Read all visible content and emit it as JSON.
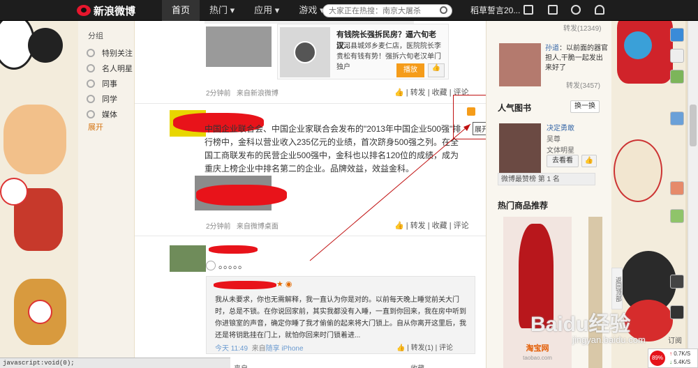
{
  "topbar": {
    "brand": "新浪微博",
    "nav": [
      "首页",
      "热门",
      "应用",
      "游戏"
    ],
    "search_placeholder": "大家正在热搜：南京大屠杀",
    "user": "稻草誓言20..."
  },
  "left": {
    "title": "分组",
    "groups": [
      "特别关注",
      "名人明星",
      "同事",
      "同学",
      "媒体"
    ],
    "expand": "展开"
  },
  "post1": {
    "card_title": "有钱院长强拆民房？逼六旬老汉...",
    "card_text": "唐河县城郊乡麦仁店，医院院长李贵松有钱有势！强拆六旬老汉单门独户",
    "card_btn": "播放",
    "time": "2分钟前",
    "source_pre": "来自",
    "source": "新浪微博",
    "acts": [
      "转发",
      "收藏",
      "评论"
    ]
  },
  "post2": {
    "text": "中国企业联合会、中国企业家联合会发布的\"2013年中国企业500强\"排行榜中，金科以营业收入235亿元的业绩，首次跻身500强之列。在全国工商联发布的民营企业500强中，金科也以排名120位的成绩，成为重庆上榜企业中排名第二的企业。品牌效益，效益金科。",
    "time": "2分钟前",
    "source_pre": "来自",
    "source": "微博桌面",
    "acts": [
      "转发",
      "收藏",
      "评论"
    ],
    "tooltip": "展开屏蔽选项"
  },
  "post3": {
    "dots": "。。。。。",
    "quote": "我从未要求，你也无需解释，我一直认为你是对的。以前每天晚上睡觉前关大门时，总是不锁。在你说回家前，其实我都没有入睡，一直到你回来，我在房中听到你进锒室的声音，确定你睡了我才偷偷的起来将大门锁上。自从你离开这里后，我还是将钥匙挂在门上，就怕你回来时门锁着进...",
    "time": "今天 11:49",
    "source_pre": "来自",
    "source": "随享 iPhone",
    "acts": [
      "转发(1)",
      "收藏",
      "评论"
    ]
  },
  "right": {
    "repost1": "转发(12349)",
    "user": "孙道",
    "text": "：以前面的器官担人,干脆一起发出来好了",
    "repost2": "转发(3457)",
    "books_title": "人气图书",
    "change": "换一换",
    "book_name": "决定勇敢",
    "book_author": "吴尊",
    "book_cat": "文体明星",
    "book_btn": "去看看",
    "book_rank": "微博最赞榜 第 1 名",
    "goods_title": "热门商品推荐",
    "taobao": "淘宝网",
    "taobao_url": "taobao.com"
  },
  "side": {
    "back": "返回顶部",
    "subscribe": "订阅",
    "net_pct": "89%",
    "up": "0.7K/S",
    "down": "5.4K/S"
  },
  "status": "javascript:void(0);",
  "watermark": {
    "brand": "Baidu经验",
    "url": "jingyan.baidu.com"
  }
}
